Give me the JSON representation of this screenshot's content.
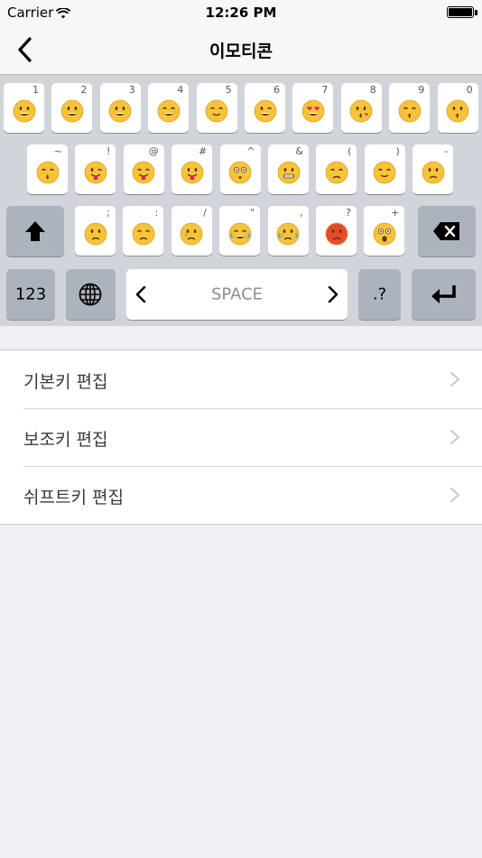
{
  "status_bar": {
    "carrier": "Carrier",
    "time": "12:26 PM",
    "battery_level": 1.0
  },
  "nav": {
    "title": "이모티콘",
    "back_icon": "chevron-left-icon"
  },
  "keyboard": {
    "row1": [
      {
        "hint": "1",
        "emoji": "grinning-face",
        "face": "#f7c33a"
      },
      {
        "hint": "2",
        "emoji": "smiley-face",
        "face": "#f7c33a"
      },
      {
        "hint": "3",
        "emoji": "grinning-face",
        "face": "#f7c33a"
      },
      {
        "hint": "4",
        "emoji": "blush-face",
        "face": "#f7c33a"
      },
      {
        "hint": "5",
        "emoji": "relaxed-face",
        "face": "#f7c33a"
      },
      {
        "hint": "6",
        "emoji": "wink-face",
        "face": "#f7c33a"
      },
      {
        "hint": "7",
        "emoji": "heart-eyes-face",
        "face": "#f7c33a"
      },
      {
        "hint": "8",
        "emoji": "kissing-heart-face",
        "face": "#f7c33a"
      },
      {
        "hint": "9",
        "emoji": "kissing-closed-eyes-face",
        "face": "#f7c33a"
      },
      {
        "hint": "0",
        "emoji": "kissing-face",
        "face": "#f7c33a"
      }
    ],
    "row2": [
      {
        "hint": "~",
        "emoji": "kissing-smiling-eyes-face",
        "face": "#f7c33a"
      },
      {
        "hint": "!",
        "emoji": "stuck-out-tongue-winking-face",
        "face": "#f7c33a"
      },
      {
        "hint": "@",
        "emoji": "stuck-out-tongue-closed-eyes-face",
        "face": "#f7c33a"
      },
      {
        "hint": "#",
        "emoji": "stuck-out-tongue-face",
        "face": "#f7c33a"
      },
      {
        "hint": "^",
        "emoji": "flushed-face",
        "face": "#f7c33a"
      },
      {
        "hint": "&",
        "emoji": "grimacing-face",
        "face": "#f7c33a"
      },
      {
        "hint": "(",
        "emoji": "pensive-face",
        "face": "#f7c33a"
      },
      {
        "hint": ")",
        "emoji": "relieved-face",
        "face": "#f7c33a"
      },
      {
        "hint": "-",
        "emoji": "unamused-face",
        "face": "#f7c33a"
      }
    ],
    "row3": [
      {
        "hint": ";",
        "emoji": "disappointed-face",
        "face": "#f7c33a"
      },
      {
        "hint": ":",
        "emoji": "confounded-face",
        "face": "#f7c33a"
      },
      {
        "hint": "/",
        "emoji": "crying-face",
        "face": "#f7c33a"
      },
      {
        "hint": "\"",
        "emoji": "joy-face",
        "face": "#f7c33a"
      },
      {
        "hint": ",",
        "emoji": "sob-face",
        "face": "#f7c33a"
      },
      {
        "hint": "?",
        "emoji": "angry-face",
        "face": "#e8492c"
      },
      {
        "hint": "+",
        "emoji": "scream-face",
        "face": "#f7c33a"
      }
    ],
    "shift_icon": "shift-arrow-icon",
    "delete_icon": "backspace-icon",
    "num_label": "123",
    "globe_icon": "globe-icon",
    "space_label": "SPACE",
    "punct_label": ".?",
    "return_icon": "return-arrow-icon"
  },
  "settings": {
    "rows": [
      {
        "label": "기본키 편집"
      },
      {
        "label": "보조키 편집"
      },
      {
        "label": "쉬프트키 편집"
      }
    ]
  }
}
